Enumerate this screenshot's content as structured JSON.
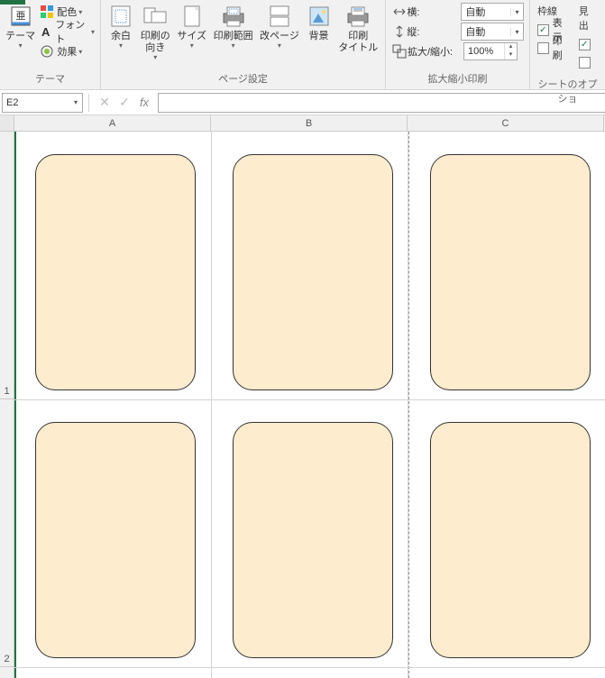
{
  "ribbon": {
    "themes": {
      "main": "テーマ",
      "colors": "配色",
      "fonts": "フォント",
      "effects": "効果",
      "group": "テーマ"
    },
    "page": {
      "margins": "余白",
      "orientation": "印刷の\n向き",
      "size": "サイズ",
      "printarea": "印刷範囲",
      "breaks": "改ページ",
      "background": "背景",
      "titles": "印刷\nタイトル",
      "group": "ページ設定"
    },
    "scale": {
      "width_lbl": "横:",
      "height_lbl": "縦:",
      "scale_lbl": "拡大/縮小:",
      "width_val": "自動",
      "height_val": "自動",
      "scale_val": "100%",
      "group": "拡大縮小印刷"
    },
    "sheetopts": {
      "grid_head": "枠線",
      "head_head": "見出",
      "view": "表示",
      "print": "印刷",
      "group": "シートのオプショ"
    }
  },
  "fbar": {
    "name": "E2",
    "formula": ""
  },
  "cols": [
    "A",
    "B",
    "C"
  ],
  "rows": [
    "1",
    "2"
  ]
}
